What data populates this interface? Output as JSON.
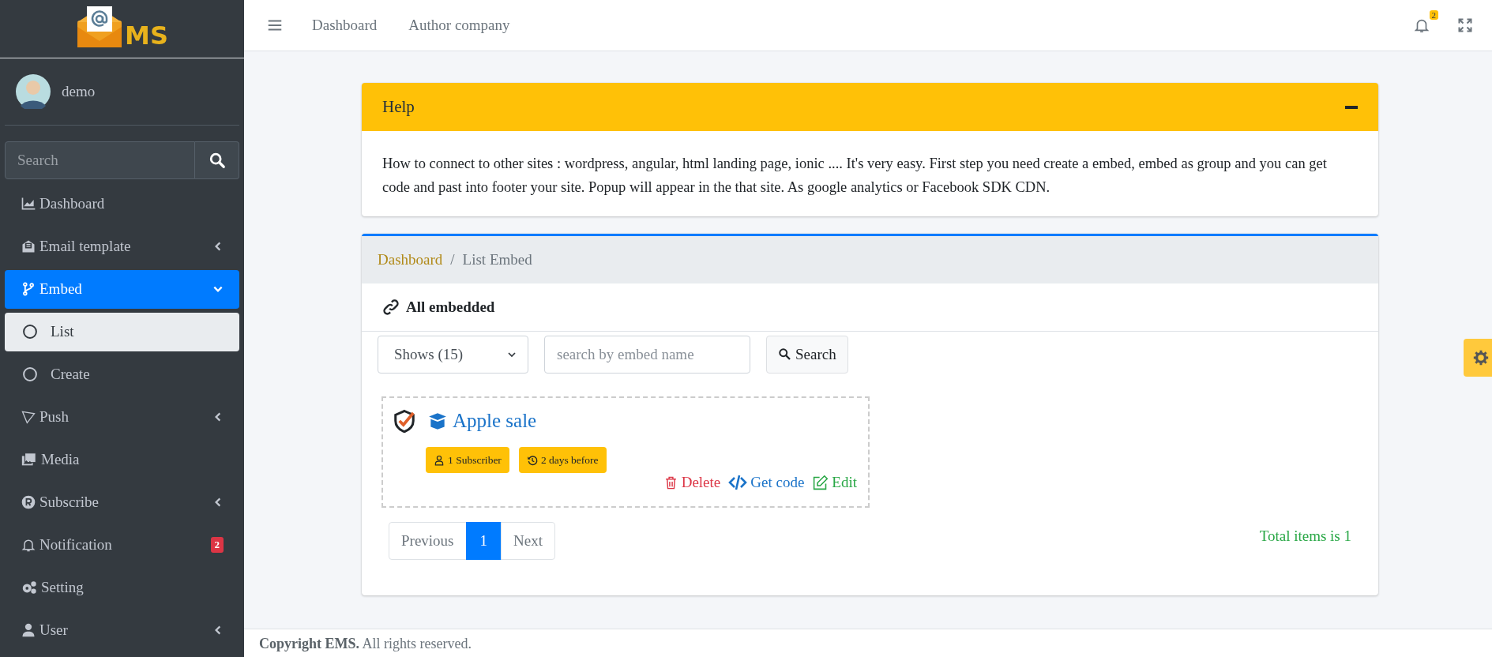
{
  "sidebar": {
    "logo_text": "MS",
    "user": {
      "name": "demo"
    },
    "search": {
      "placeholder": "Search"
    },
    "menu": [
      {
        "label": "Dashboard",
        "selected": false
      },
      {
        "label": "Email template",
        "selected": false,
        "expanded": false
      },
      {
        "label": "Embed",
        "selected": true,
        "expanded": true,
        "children": [
          {
            "label": "List",
            "selected": true
          },
          {
            "label": "Create",
            "selected": false
          }
        ]
      },
      {
        "label": "Push",
        "selected": false,
        "expanded": false
      },
      {
        "label": "Media",
        "selected": false
      },
      {
        "label": "Subscribe",
        "selected": false,
        "expanded": false
      },
      {
        "label": "Notification",
        "selected": false,
        "badge": "2"
      },
      {
        "label": "Setting",
        "selected": false
      },
      {
        "label": "User",
        "selected": false,
        "expanded": false
      }
    ]
  },
  "topbar": {
    "links": [
      "Dashboard",
      "Author company"
    ],
    "notification_count": "2"
  },
  "help": {
    "title": "Help",
    "body": "How to connect to other sites : wordpress, angular, html landing page, ionic .... It's very easy. First step you need create a embed, embed as group and you can get code and past into footer your site. Popup will appear in the that site. As google analytics or Facebook SDK CDN."
  },
  "list": {
    "breadcrumb": [
      {
        "label": "Dashboard",
        "link": true
      },
      {
        "label": "List Embed",
        "link": false
      }
    ],
    "breadcrumb_separator": "/",
    "title": "All embedded",
    "page_size": "Shows (15)",
    "search": {
      "placeholder": "search by embed name"
    },
    "search_button": "Search",
    "embeds": [
      {
        "title": "Apple sale",
        "badges": [
          {
            "kind": "subscribers",
            "label": "1 Subscriber"
          },
          {
            "kind": "time",
            "label": "2 days before"
          }
        ],
        "actions": [
          {
            "kind": "delete",
            "label": "Delete"
          },
          {
            "kind": "code",
            "label": "Get code"
          },
          {
            "kind": "edit",
            "label": "Edit"
          }
        ]
      }
    ],
    "pagination": [
      {
        "label": "Previous",
        "selected": false
      },
      {
        "label": "1",
        "selected": true
      },
      {
        "label": "Next",
        "selected": false
      }
    ],
    "total": "Total items is 1"
  },
  "footer": "**Copyright EMS.** All rights reserved."
}
